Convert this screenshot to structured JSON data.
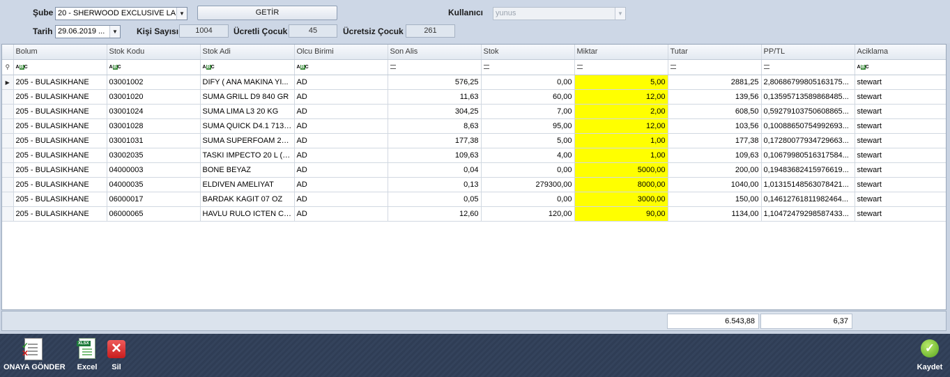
{
  "filters": {
    "sube_label": "Şube",
    "sube_value": "20 - SHERWOOD EXCLUSIVE LA...",
    "getir_label": "GETİR",
    "kullanici_label": "Kullanıcı",
    "kullanici_value": "yunus",
    "tarih_label": "Tarih",
    "tarih_value": "29.06.2019 ...",
    "kisi_sayisi_label": "Kişi Sayısı",
    "kisi_sayisi_value": "1004",
    "ucretli_cocuk_label": "Ücretli Çocuk",
    "ucretli_cocuk_value": "45",
    "ucretsiz_cocuk_label": "Ücretsiz Çocuk",
    "ucretsiz_cocuk_value": "261"
  },
  "grid": {
    "columns": [
      "Bolum",
      "Stok Kodu",
      "Stok Adi",
      "Olcu Birimi",
      "Son Alis",
      "Stok",
      "Miktar",
      "Tutar",
      "PP/TL",
      "Aciklama"
    ],
    "filter_row_icons": [
      "abc-filter-icon",
      "abc-filter-icon",
      "abc-filter-icon",
      "abc-filter-icon",
      "equals-filter-icon",
      "equals-filter-icon",
      "equals-filter-icon",
      "equals-filter-icon",
      "equals-filter-icon",
      "abc-filter-icon"
    ],
    "rows": [
      [
        "205 - BULASIKHANE",
        "03001002",
        "DIFY ( ANA MAKINA YI...",
        "AD",
        "576,25",
        "0,00",
        "5,00",
        "2881,25",
        "2,80686799805163175...",
        "stewart"
      ],
      [
        "205 - BULASIKHANE",
        "03001020",
        "SUMA GRILL D9 840 GR",
        "AD",
        "11,63",
        "60,00",
        "12,00",
        "139,56",
        "0,13595713589868485...",
        "stewart"
      ],
      [
        "205 - BULASIKHANE",
        "03001024",
        "SUMA LIMA L3 20 KG",
        "AD",
        "304,25",
        "7,00",
        "2,00",
        "608,50",
        "0,59279103750608865...",
        "stewart"
      ],
      [
        "205 - BULASIKHANE",
        "03001028",
        "SUMA QUICK D4.1 713 ...",
        "AD",
        "8,63",
        "95,00",
        "12,00",
        "103,56",
        "0,10088650754992693...",
        "stewart"
      ],
      [
        "205 - BULASIKHANE",
        "03001031",
        "SUMA SUPERFOAM 22,...",
        "AD",
        "177,38",
        "5,00",
        "1,00",
        "177,38",
        "0,17280077934729663...",
        "stewart"
      ],
      [
        "205 - BULASIKHANE",
        "03002035",
        "TASKI IMPECTO 20 L (2...",
        "AD",
        "109,63",
        "4,00",
        "1,00",
        "109,63",
        "0,10679980516317584...",
        "stewart"
      ],
      [
        "205 - BULASIKHANE",
        "04000003",
        "BONE BEYAZ",
        "AD",
        "0,04",
        "0,00",
        "5000,00",
        "200,00",
        "0,19483682415976619...",
        "stewart"
      ],
      [
        "205 - BULASIKHANE",
        "04000035",
        "ELDIVEN AMELIYAT",
        "AD",
        "0,13",
        "279300,00",
        "8000,00",
        "1040,00",
        "1,01315148563078421...",
        "stewart"
      ],
      [
        "205 - BULASIKHANE",
        "06000017",
        "BARDAK KAGIT 07 OZ",
        "AD",
        "0,05",
        "0,00",
        "3000,00",
        "150,00",
        "0,14612761811982464...",
        "stewart"
      ],
      [
        "205 - BULASIKHANE",
        "06000065",
        "HAVLU RULO ICTEN CE...",
        "AD",
        "12,60",
        "120,00",
        "90,00",
        "1134,00",
        "1,10472479298587433...",
        "stewart"
      ]
    ],
    "tutar_total": "6.543,88",
    "pptl_total": "6,37"
  },
  "toolbar": {
    "onaya_gonder_label": "ONAYA GÖNDER",
    "excel_label": "Excel",
    "sil_label": "Sil",
    "kaydet_label": "Kaydet"
  },
  "colors": {
    "highlight_column": "#ffff00",
    "toolbar_background": "#2f3d55"
  }
}
